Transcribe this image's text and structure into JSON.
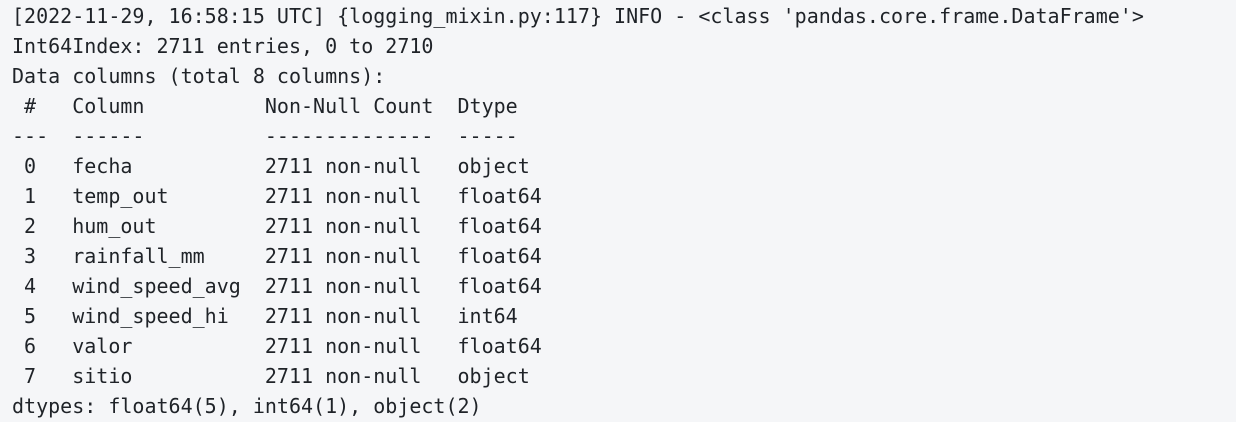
{
  "log": {
    "lines": [
      "[2022-11-29, 16:58:15 UTC] {logging_mixin.py:117} INFO - <class 'pandas.core.frame.DataFrame'>",
      "Int64Index: 2711 entries, 0 to 2710",
      "Data columns (total 8 columns):",
      " #   Column          Non-Null Count  Dtype  ",
      "---  ------          --------------  -----  ",
      " 0   fecha           2711 non-null   object ",
      " 1   temp_out        2711 non-null   float64",
      " 2   hum_out         2711 non-null   float64",
      " 3   rainfall_mm     2711 non-null   float64",
      " 4   wind_speed_avg  2711 non-null   float64",
      " 5   wind_speed_hi   2711 non-null   int64  ",
      " 6   valor           2711 non-null   float64",
      " 7   sitio           2711 non-null   object ",
      "dtypes: float64(5), int64(1), object(2)"
    ]
  }
}
